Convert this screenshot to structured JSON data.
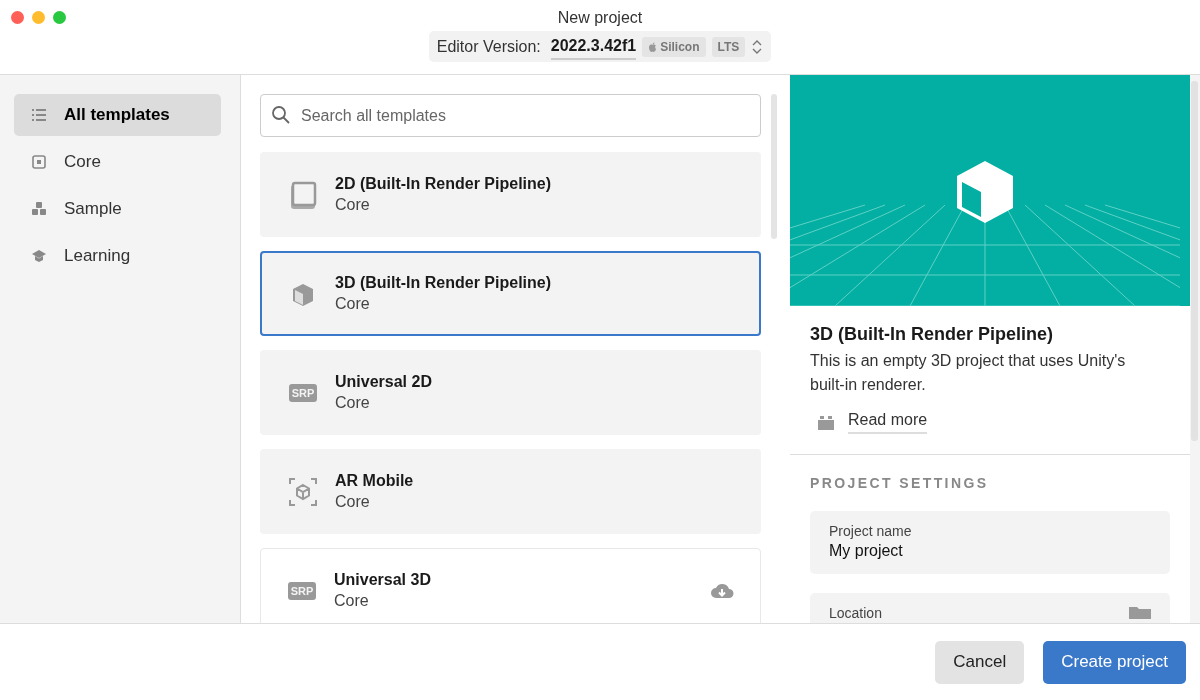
{
  "window": {
    "title": "New project"
  },
  "editor_version": {
    "label": "Editor Version:",
    "value": "2022.3.42f1",
    "badges": [
      "Silicon",
      "LTS"
    ]
  },
  "sidebar": {
    "items": [
      {
        "label": "All templates",
        "kind": "list",
        "selected": true
      },
      {
        "label": "Core",
        "kind": "core",
        "selected": false
      },
      {
        "label": "Sample",
        "kind": "sample",
        "selected": false
      },
      {
        "label": "Learning",
        "kind": "learning",
        "selected": false
      }
    ]
  },
  "search": {
    "placeholder": "Search all templates"
  },
  "templates": [
    {
      "title": "2D (Built-In Render Pipeline)",
      "category": "Core",
      "kind": "square",
      "selected": false,
      "downloadable": false
    },
    {
      "title": "3D (Built-In Render Pipeline)",
      "category": "Core",
      "kind": "cube",
      "selected": true,
      "downloadable": false
    },
    {
      "title": "Universal 2D",
      "category": "Core",
      "kind": "srp",
      "icon_text": "SRP",
      "selected": false,
      "downloadable": false
    },
    {
      "title": "AR Mobile",
      "category": "Core",
      "kind": "ar",
      "selected": false,
      "downloadable": false
    },
    {
      "title": "Universal 3D",
      "category": "Core",
      "kind": "srp",
      "icon_text": "SRP",
      "selected": false,
      "downloadable": true
    }
  ],
  "details": {
    "title": "3D (Built-In Render Pipeline)",
    "description": "This is an empty 3D project that uses Unity's built-in renderer.",
    "read_more": "Read more"
  },
  "project_settings": {
    "heading": "PROJECT SETTINGS",
    "fields": [
      {
        "label": "Project name",
        "value": "My project"
      },
      {
        "label": "Location"
      }
    ]
  },
  "buttons": [
    {
      "label": "Cancel",
      "kind": "secondary"
    },
    {
      "label": "Create project",
      "kind": "primary"
    }
  ]
}
